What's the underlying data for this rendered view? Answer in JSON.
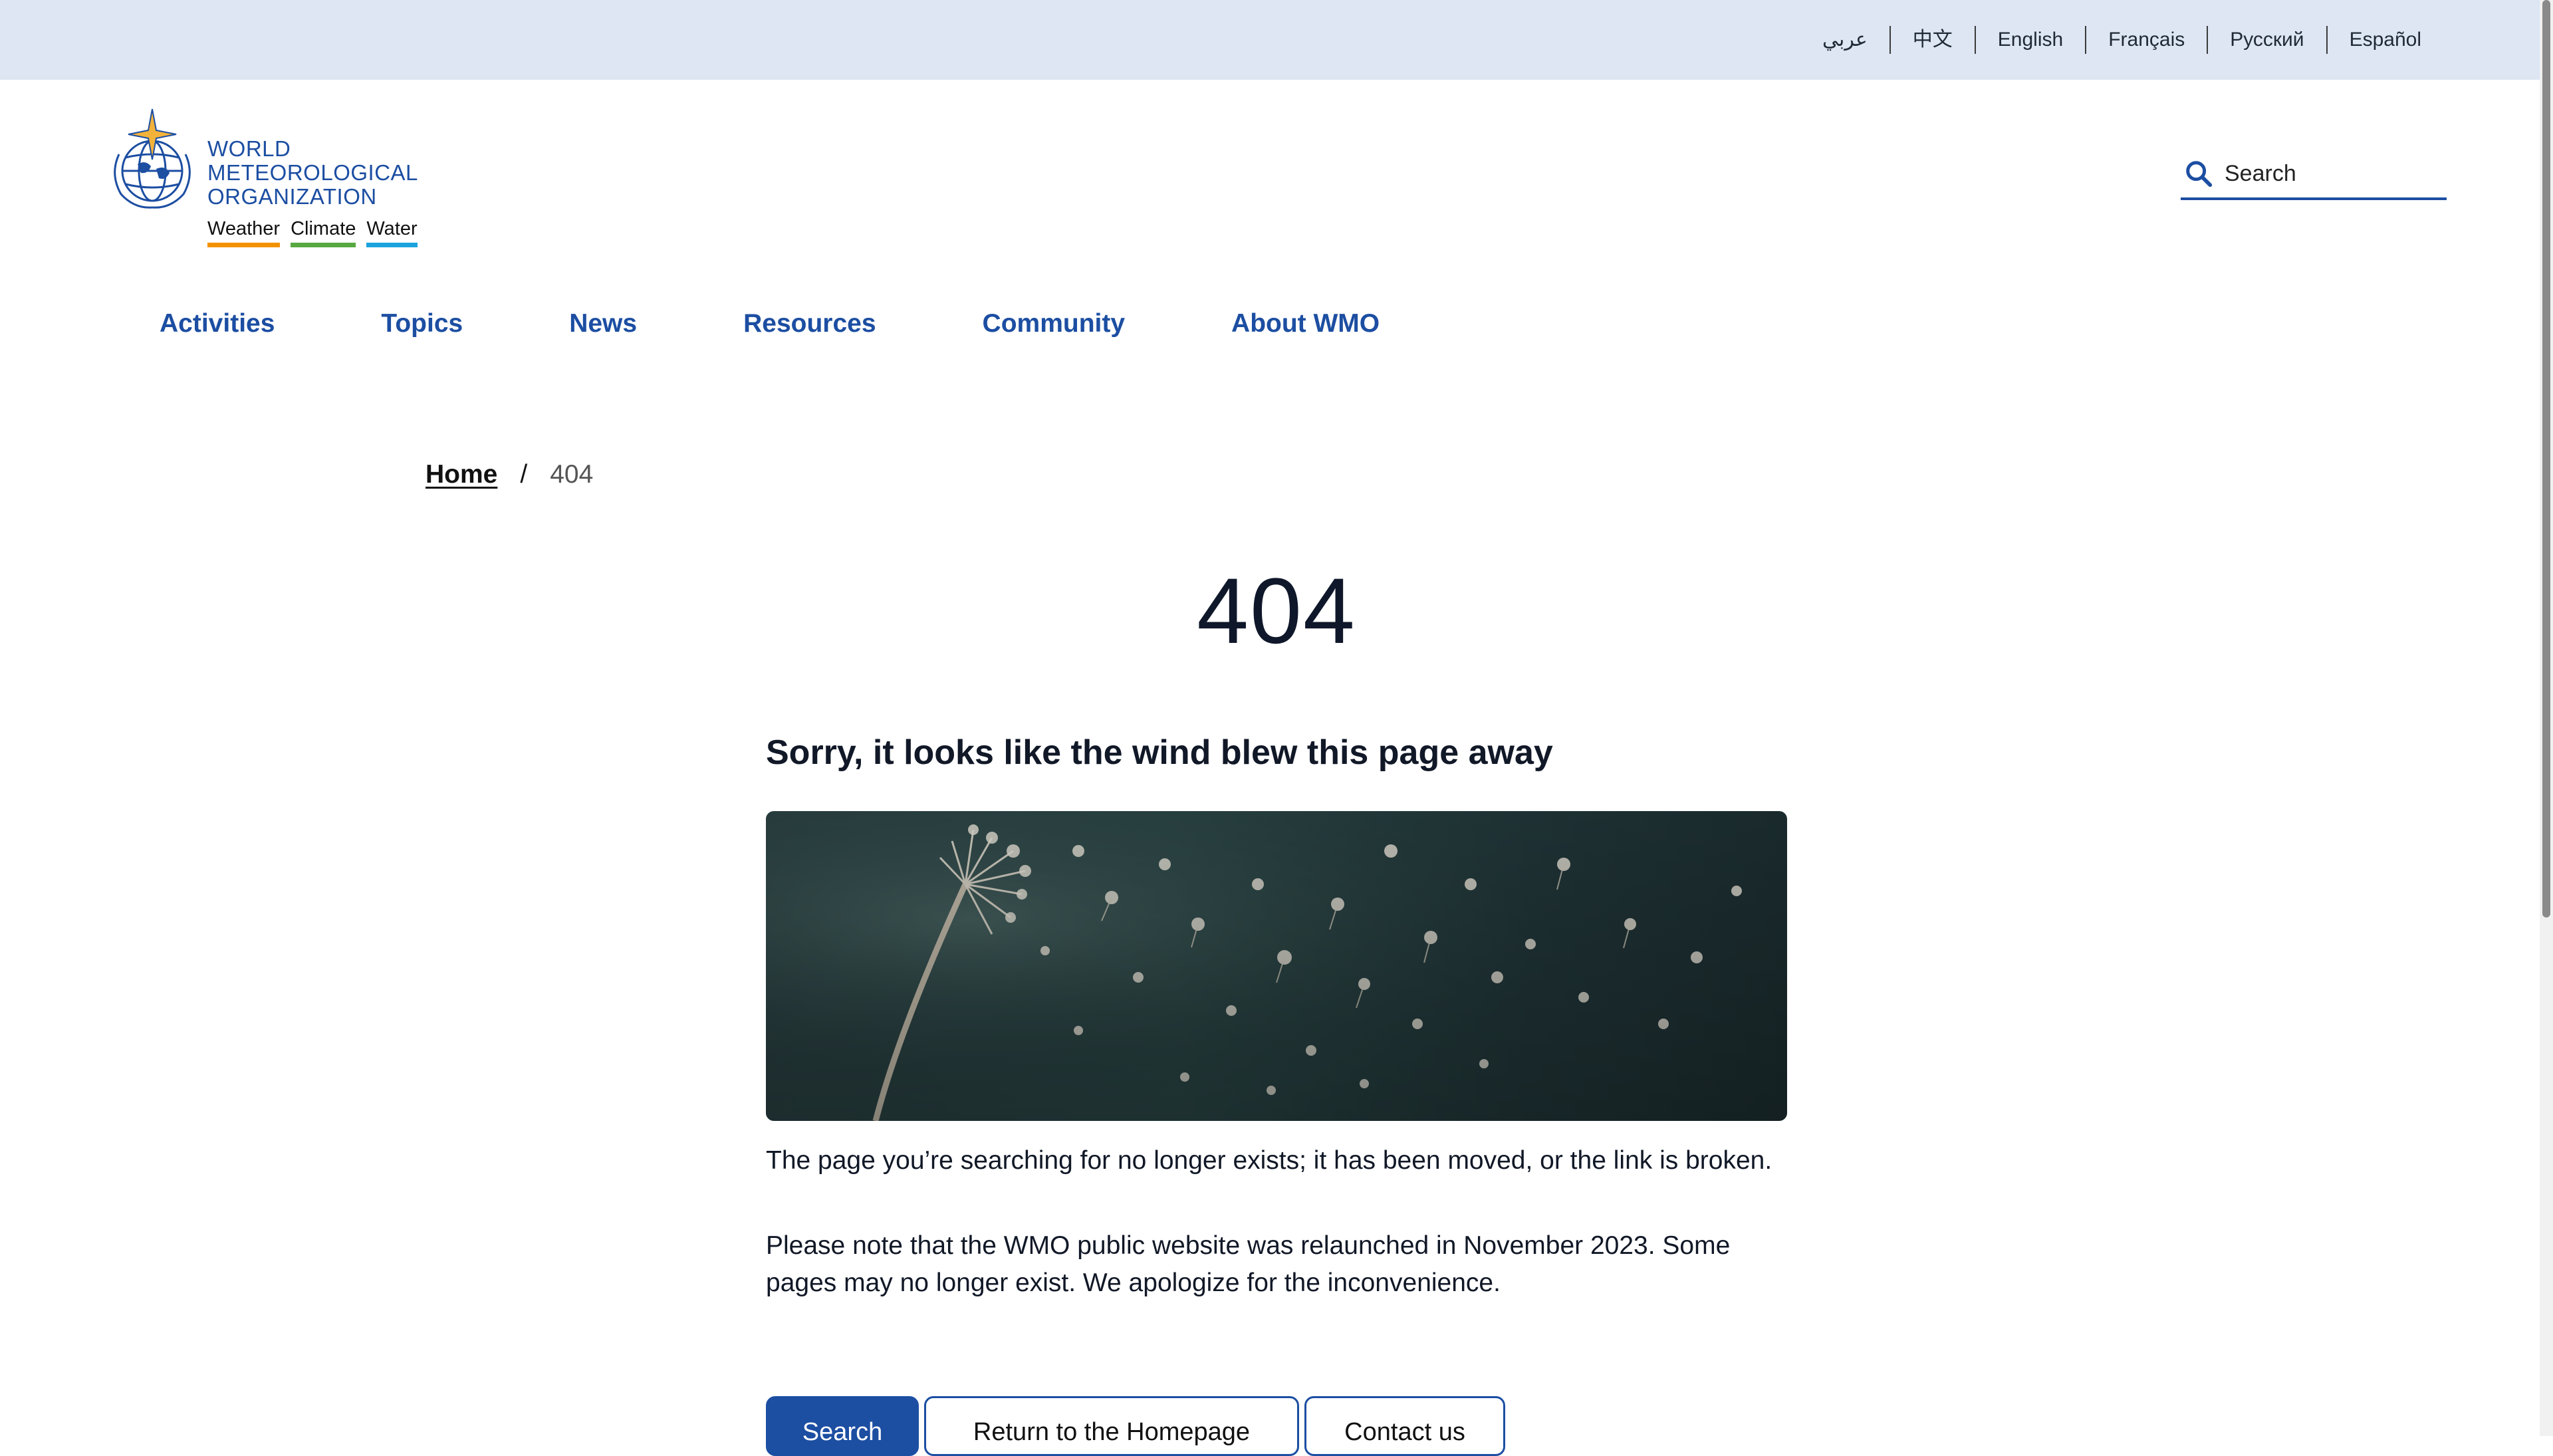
{
  "languages": [
    "عربي",
    "中文",
    "English",
    "Français",
    "Русский",
    "Español"
  ],
  "logo": {
    "line1": "WORLD",
    "line2": "METEOROLOGICAL",
    "line3": "ORGANIZATION",
    "taglines": [
      "Weather",
      "Climate",
      "Water"
    ]
  },
  "search": {
    "placeholder": "Search"
  },
  "nav": [
    "Activities",
    "Topics",
    "News",
    "Resources",
    "Community",
    "About WMO"
  ],
  "breadcrumb": {
    "home": "Home",
    "separator": "/",
    "current": "404"
  },
  "main": {
    "code": "404",
    "heading": "Sorry, it looks like the wind blew this page away",
    "paragraph1": "The page you’re searching for no longer exists; it has been moved, or the link is broken.",
    "paragraph2": "Please note that the WMO public website was relaunched in November 2023. Some pages may no longer exist. We apologize for the inconvenience.",
    "buttons": {
      "search": "Search",
      "home": "Return to the Homepage",
      "contact": "Contact us"
    }
  },
  "colors": {
    "brand": "#1c4ea2",
    "langbar": "#dde6f2",
    "weather": "#f39200",
    "climate": "#58a942",
    "water": "#1aa3dc"
  }
}
